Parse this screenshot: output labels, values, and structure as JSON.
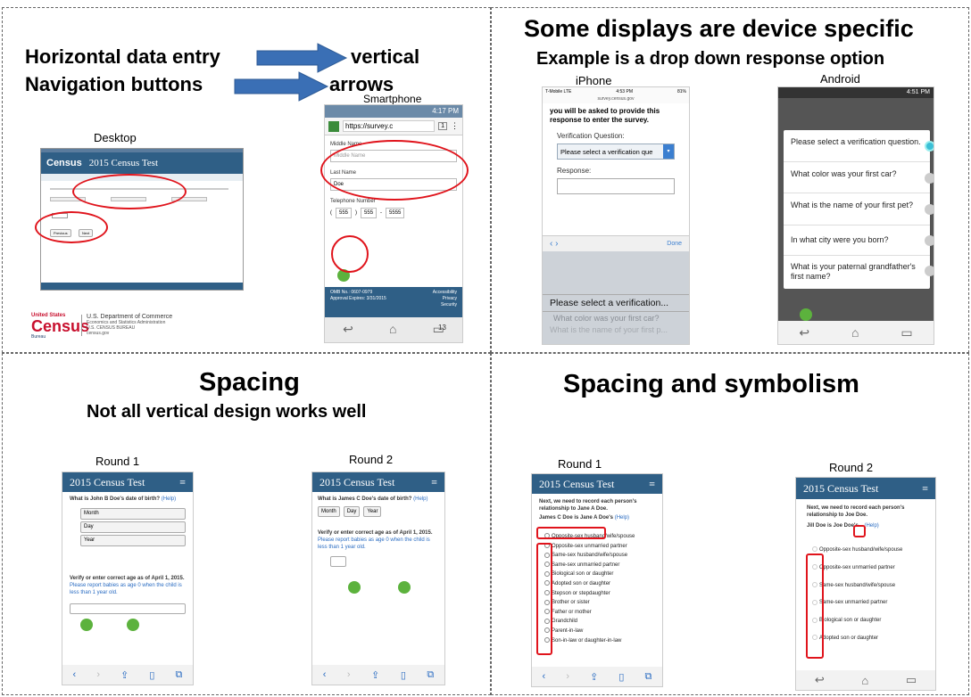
{
  "q1": {
    "line1_left": "Horizontal data entry",
    "line1_right": "vertical",
    "line2_left": "Navigation buttons",
    "line2_right": "arrows",
    "desktop_label": "Desktop",
    "smartphone_label": "Smartphone",
    "desktop": {
      "brand": "Census",
      "title": "2015 Census Test",
      "prev": "Previous",
      "next": "Next"
    },
    "phone": {
      "time": "4:17 PM",
      "url": "https://survey.c",
      "tab_count": "1",
      "middle_name_label": "Middle Name",
      "middle_name_placeholder": "Middle Name",
      "last_name_label": "Last Name",
      "last_name_value": "Doe",
      "tel_label": "Telephone Number",
      "tel_area": "555",
      "tel_prefix": "555",
      "tel_line": "5555",
      "omb": "OMB No.: 0607-0979",
      "approval": "Approval Expires: 3/31/2015",
      "accessibility": "Accessibility",
      "privacy": "Privacy",
      "security": "Security"
    },
    "logo_top": "United States",
    "logo_word": "Census",
    "logo_bureau": "Bureau",
    "doc_line1": "U.S. Department of Commerce",
    "doc_line2": "Economics and Statistics Administration",
    "doc_line3": "U.S. CENSUS BUREAU",
    "doc_line4": "census.gov",
    "slide_number": "13"
  },
  "q2": {
    "title": "Some displays are device specific",
    "subtitle": "Example is a drop down response option",
    "iphone_label": "iPhone",
    "android_label": "Android",
    "iphone": {
      "carrier": "T-Mobile  LTE",
      "time": "4:53 PM",
      "battery": "81%",
      "url": "survey.census.gov",
      "intro": "you will be asked to provide this response to enter the survey.",
      "vq_label": "Verification Question:",
      "select_value": "Please select a verification que",
      "response_label": "Response:",
      "done": "Done",
      "picker": [
        "Please select a verification...",
        "What color was your first car?",
        "What is the name of your first p..."
      ]
    },
    "android": {
      "time": "4:51 PM",
      "options": [
        "Please select a verification question.",
        "What color was your first car?",
        "What is the name of your first pet?",
        "In what city were you born?",
        "What is your paternal grandfather's first name?"
      ]
    }
  },
  "q3": {
    "title": "Spacing",
    "subtitle": "Not all vertical design works well",
    "round1_label": "Round 1",
    "round2_label": "Round 2",
    "app_title": "2015 Census Test",
    "r1": {
      "question": "What is John B Doe's date of birth?",
      "help": "(Help)",
      "month": "Month",
      "day": "Day",
      "year": "Year",
      "verify": "Verify or enter correct age as of April 1, 2015.",
      "verify_note": "Please report babies as age 0 when the child is less than 1 year old."
    },
    "r2": {
      "question": "What is James C Doe's date of birth?",
      "help": "(Help)",
      "month": "Month",
      "day": "Day",
      "year": "Year",
      "verify": "Verify or enter correct age as of April 1, 2015.",
      "verify_note": "Please report babies as age 0 when the child is less than 1 year old."
    }
  },
  "q4": {
    "title": "Spacing and symbolism",
    "round1_label": "Round 1",
    "round2_label": "Round 2",
    "app_title": "2015 Census Test",
    "r1": {
      "intro": "Next, we need to record each person's relationship to Jane A Doe.",
      "person": "James C Doe is Jane A Doe's",
      "help": "(Help)",
      "options": [
        "Opposite-sex husband/wife/spouse",
        "Opposite-sex unmarried partner",
        "Same-sex husband/wife/spouse",
        "Same-sex unmarried partner",
        "Biological son or daughter",
        "Adopted son or daughter",
        "Stepson or stepdaughter",
        "Brother or sister",
        "Father or mother",
        "Grandchild",
        "Parent-in-law",
        "Son-in-law or daughter-in-law"
      ]
    },
    "r2": {
      "intro": "Next, we need to record each person's relationship to Joe Doe.",
      "person": "Jill Doe is Joe Doe's...",
      "help": "(Help)",
      "options": [
        "Opposite-sex husband/wife/spouse",
        "Opposite-sex unmarried partner",
        "Same-sex husband/wife/spouse",
        "Same-sex unmarried partner",
        "Biological son or daughter",
        "Adopted son or daughter"
      ]
    }
  },
  "colors": {
    "census_blue": "#2f5f86",
    "annotation_red": "#e0141c",
    "arrow_blue": "#3a6fb5",
    "nav_green": "#5cb23d"
  }
}
